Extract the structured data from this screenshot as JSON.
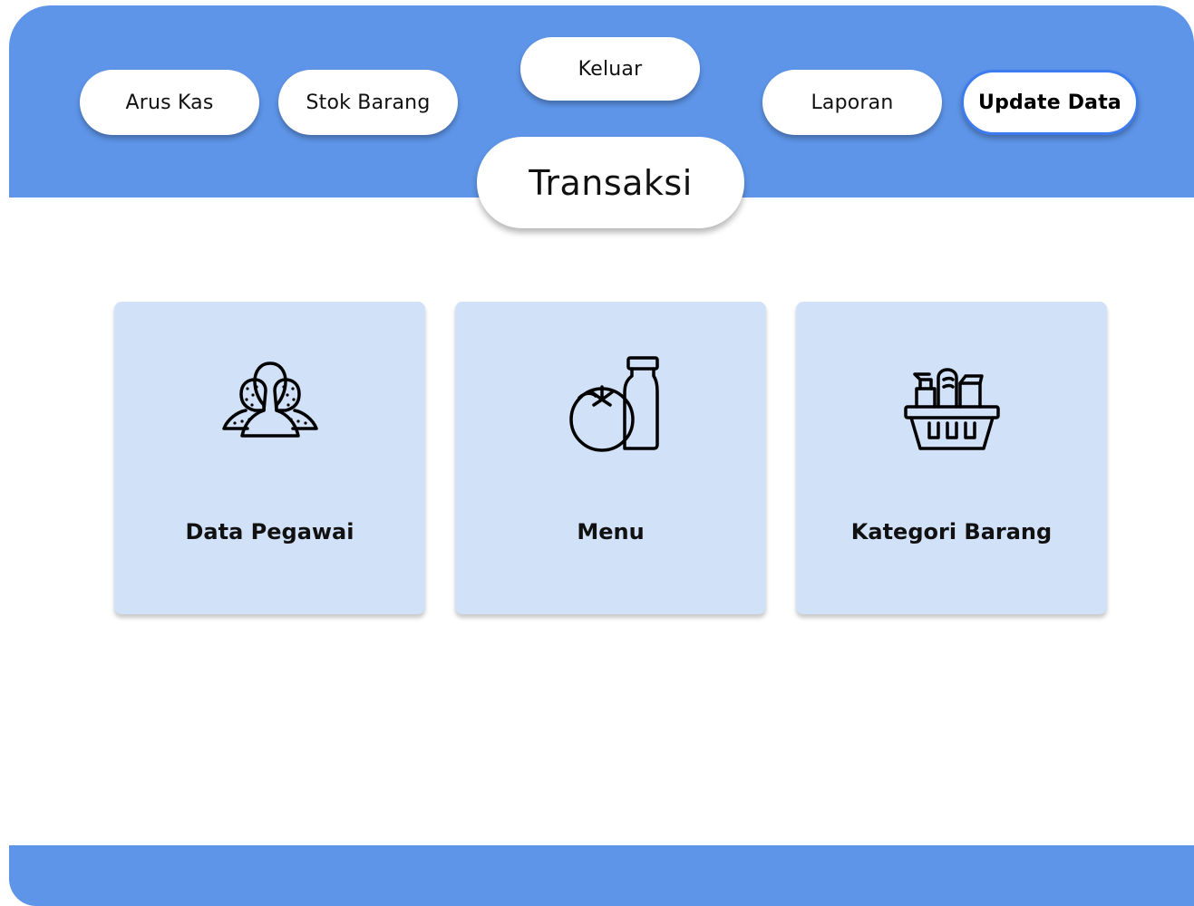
{
  "nav": {
    "arus_kas": "Arus Kas",
    "stok_barang": "Stok Barang",
    "keluar": "Keluar",
    "laporan": "Laporan",
    "update_data": "Update Data"
  },
  "page_title": "Transaksi",
  "cards": [
    {
      "label": "Data Pegawai",
      "icon": "people-icon"
    },
    {
      "label": "Menu",
      "icon": "food-drink-icon"
    },
    {
      "label": "Kategori Barang",
      "icon": "grocery-basket-icon"
    }
  ],
  "colors": {
    "header_blue": "#5E95E8",
    "card_bg": "#D1E1F8",
    "active_border": "#3D7CF0"
  }
}
